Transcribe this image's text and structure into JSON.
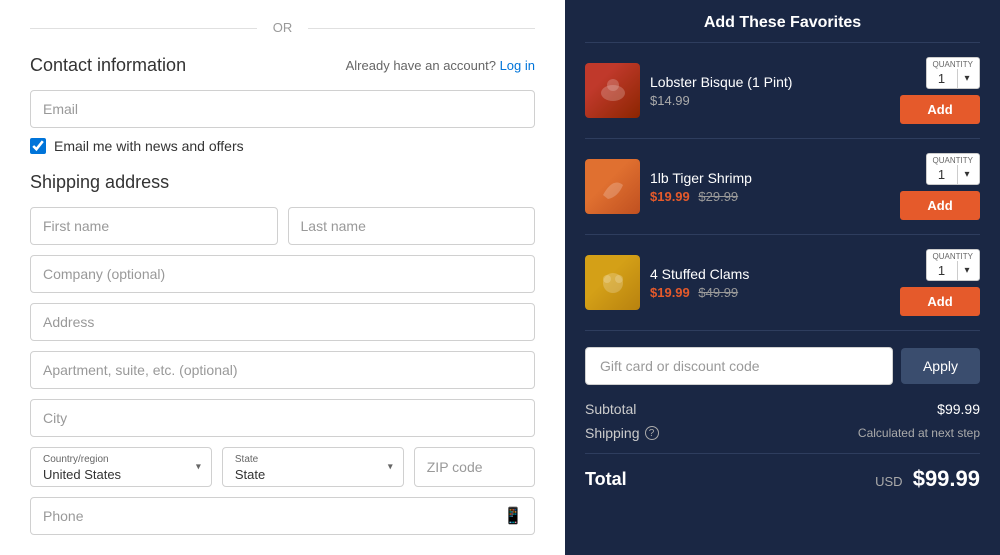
{
  "left": {
    "or_text": "OR",
    "contact": {
      "title": "Contact information",
      "account_text": "Already have an account?",
      "login_link": "Log in",
      "email_placeholder": "Email",
      "newsletter_label": "Email me with news and offers",
      "newsletter_checked": true
    },
    "shipping": {
      "title": "Shipping address",
      "first_name_placeholder": "First name",
      "last_name_placeholder": "Last name",
      "company_placeholder": "Company (optional)",
      "address_placeholder": "Address",
      "apartment_placeholder": "Apartment, suite, etc. (optional)",
      "city_placeholder": "City",
      "country_label": "Country/region",
      "country_value": "United States",
      "state_label": "State",
      "state_value": "State",
      "zip_placeholder": "ZIP code",
      "phone_placeholder": "Phone"
    }
  },
  "right": {
    "section_title": "Add These Favorites",
    "products": [
      {
        "name": "Lobster Bisque (1 Pint)",
        "sale_price": "$14.99",
        "original_price": null,
        "quantity": "1",
        "quantity_label": "QUANTITY",
        "add_label": "Add",
        "type": "lobster"
      },
      {
        "name": "1lb Tiger Shrimp",
        "sale_price": "$19.99",
        "original_price": "$29.99",
        "quantity": "1",
        "quantity_label": "QUANTITY",
        "add_label": "Add",
        "type": "shrimp"
      },
      {
        "name": "4 Stuffed Clams",
        "sale_price": "$19.99",
        "original_price": "$49.99",
        "quantity": "1",
        "quantity_label": "QUANTITY",
        "add_label": "Add",
        "type": "clams"
      }
    ],
    "discount": {
      "placeholder": "Gift card or discount code",
      "apply_label": "Apply"
    },
    "summary": {
      "subtotal_label": "Subtotal",
      "subtotal_value": "$99.99",
      "shipping_label": "Shipping",
      "shipping_value": "Calculated at next step",
      "total_label": "Total",
      "total_currency": "USD",
      "total_value": "$99.99"
    }
  }
}
